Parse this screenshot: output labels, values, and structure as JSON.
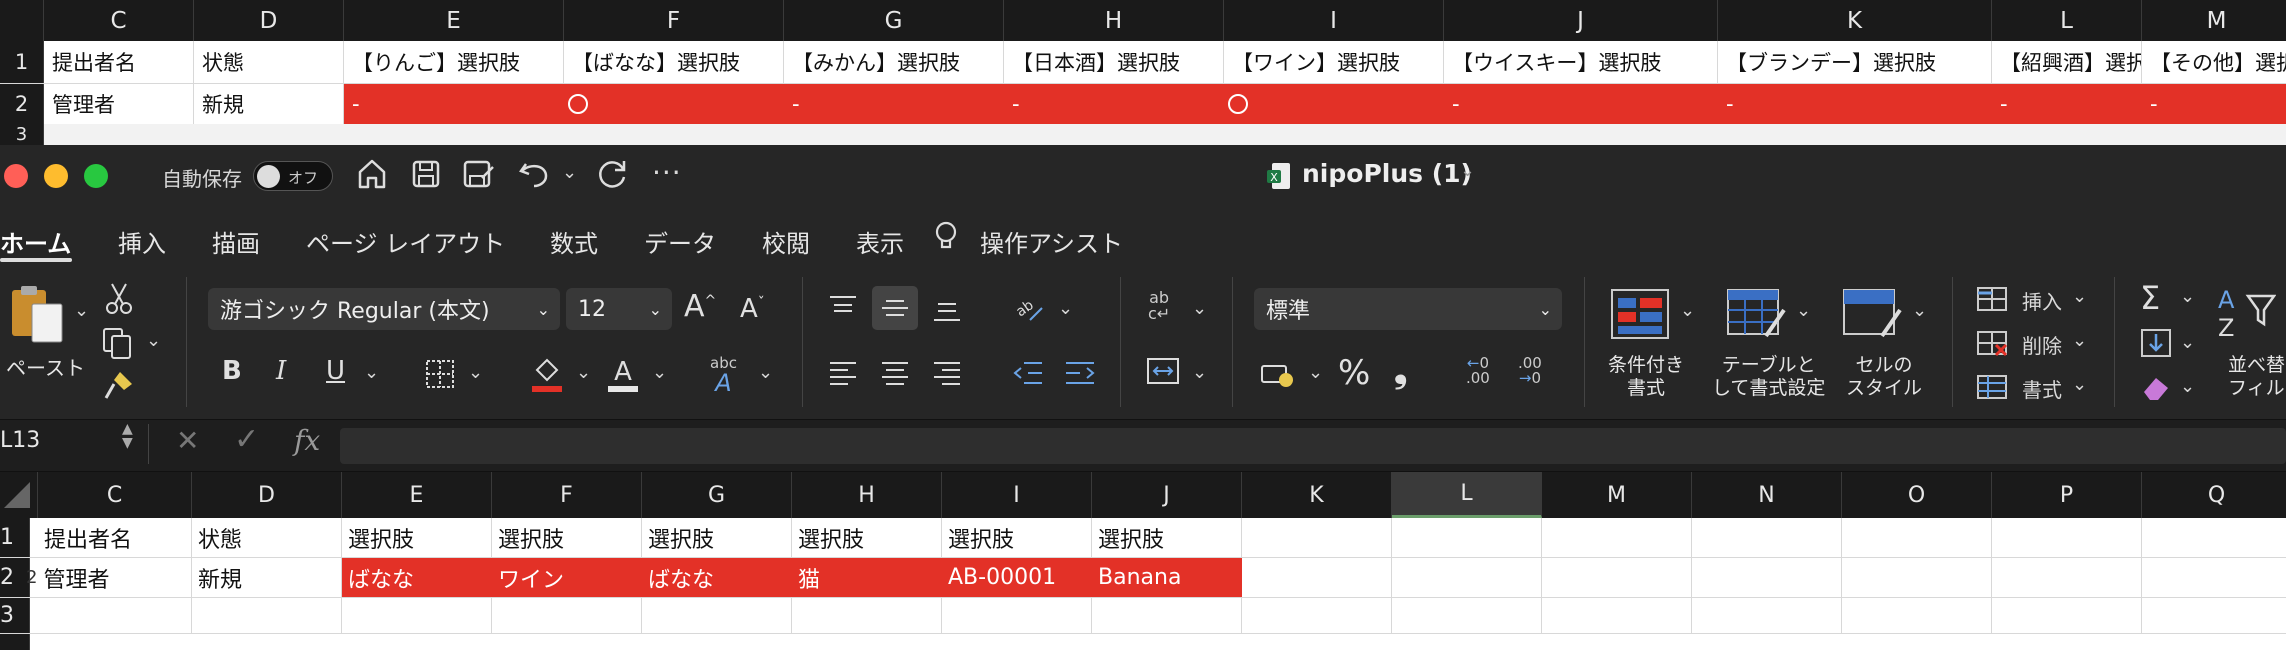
{
  "top_grid": {
    "columns": [
      "C",
      "D",
      "E",
      "F",
      "G",
      "H",
      "I",
      "J",
      "K",
      "L",
      "M"
    ],
    "row_numbers": [
      "1",
      "2",
      "3"
    ],
    "row1": [
      "提出者名",
      "状態",
      "【りんご】選択肢",
      "【ばなな】選択肢",
      "【みかん】選択肢",
      "【日本酒】選択肢",
      "【ワイン】選択肢",
      "【ウイスキー】選択肢",
      "【ブランデー】選択肢",
      "【紹興酒】選択肢",
      "【その他】選択肢"
    ],
    "row2": [
      "管理者",
      "新規",
      "-",
      "○",
      "-",
      "-",
      "○",
      "-",
      "-",
      "-",
      "-"
    ]
  },
  "titlebar": {
    "autosave_label": "自動保存",
    "autosave_state": "オフ",
    "doc_title": "nipoPlus (1)"
  },
  "ribbon_tabs": [
    "ホーム",
    "挿入",
    "描画",
    "ページ レイアウト",
    "数式",
    "データ",
    "校閲",
    "表示",
    "操作アシスト"
  ],
  "ribbon": {
    "paste_label": "ペースト",
    "font_name": "游ゴシック Regular (本文)",
    "font_size": "12",
    "number_format": "標準",
    "cond_format_label": [
      "条件付き",
      "書式"
    ],
    "table_format_label": [
      "テーブルと",
      "して書式設定"
    ],
    "cell_style_label": [
      "セルの",
      "スタイル"
    ],
    "insert_label": "挿入",
    "delete_label": "削除",
    "format_label": "書式",
    "sort_label": [
      "並べ替え",
      "フィルタ"
    ],
    "bold": "B",
    "italic": "I",
    "underline": "U"
  },
  "formula_bar": {
    "cell_ref": "L13",
    "fx": "fx",
    "value": ""
  },
  "bottom_grid": {
    "columns": [
      "C",
      "D",
      "E",
      "F",
      "G",
      "H",
      "I",
      "J",
      "K",
      "L",
      "M",
      "N",
      "O",
      "P",
      "Q"
    ],
    "selected_column": "L",
    "row_numbers": [
      "1",
      "2",
      "3"
    ],
    "row2_prefix": "2",
    "row1": [
      "提出者名",
      "状態",
      "選択肢",
      "選択肢",
      "選択肢",
      "選択肢",
      "選択肢",
      "選択肢"
    ],
    "row2": [
      "管理者",
      "新規",
      "ばなな",
      "ワイン",
      "ばなな",
      "猫",
      "AB-00001",
      "Banana"
    ]
  },
  "colors": {
    "highlight_red": "#e33127",
    "close_dot": "#ff5f57",
    "min_dot": "#febc2e",
    "max_dot": "#28c840"
  }
}
